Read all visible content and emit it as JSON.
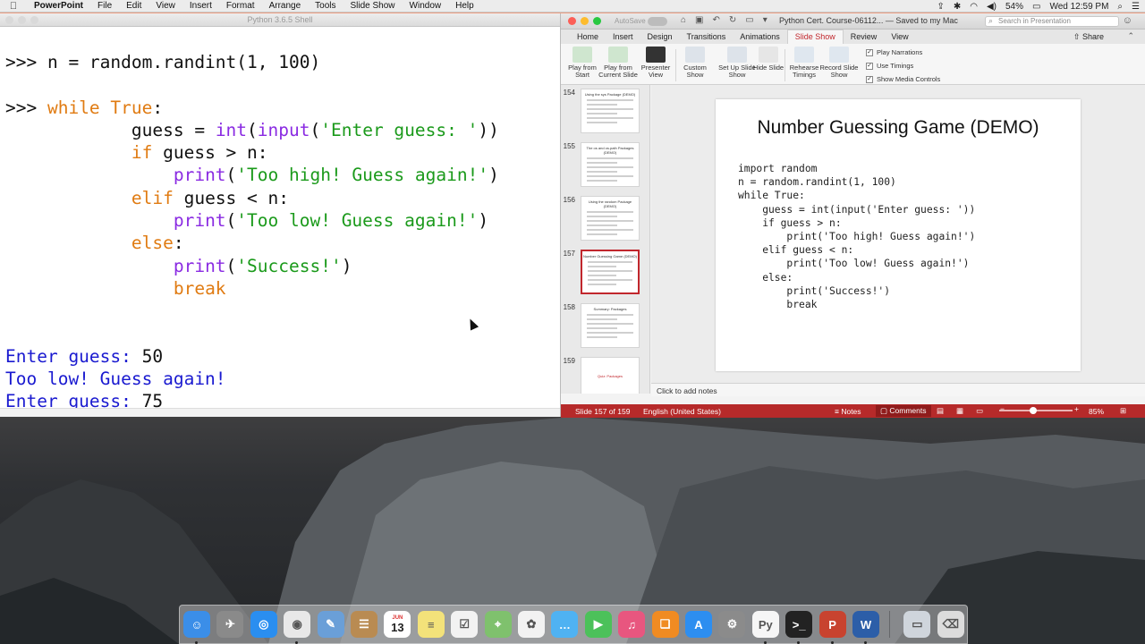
{
  "menubar": {
    "app": "PowerPoint",
    "items": [
      "File",
      "Edit",
      "View",
      "Insert",
      "Format",
      "Arrange",
      "Tools",
      "Slide Show",
      "Window",
      "Help"
    ],
    "battery": "54%",
    "clock": "Wed 12:59 PM"
  },
  "shell": {
    "title": "Python 3.6.5 Shell",
    "lines": [
      [
        {
          "t": ">>> n = random.randint(1, 100)",
          "c": ""
        }
      ],
      [
        {
          "t": "",
          "c": ""
        }
      ],
      [
        {
          "t": ">>> ",
          "c": ""
        },
        {
          "t": "while",
          "c": "kw"
        },
        {
          "t": " ",
          "c": ""
        },
        {
          "t": "True",
          "c": "kw"
        },
        {
          "t": ":",
          "c": ""
        }
      ],
      [
        {
          "t": "            guess = ",
          "c": ""
        },
        {
          "t": "int",
          "c": "bi"
        },
        {
          "t": "(",
          "c": ""
        },
        {
          "t": "input",
          "c": "bi"
        },
        {
          "t": "(",
          "c": ""
        },
        {
          "t": "'Enter guess: '",
          "c": "st"
        },
        {
          "t": "))",
          "c": ""
        }
      ],
      [
        {
          "t": "            ",
          "c": ""
        },
        {
          "t": "if",
          "c": "kw"
        },
        {
          "t": " guess > n:",
          "c": ""
        }
      ],
      [
        {
          "t": "                ",
          "c": ""
        },
        {
          "t": "print",
          "c": "bi"
        },
        {
          "t": "(",
          "c": ""
        },
        {
          "t": "'Too high! Guess again!'",
          "c": "st"
        },
        {
          "t": ")",
          "c": ""
        }
      ],
      [
        {
          "t": "            ",
          "c": ""
        },
        {
          "t": "elif",
          "c": "kw"
        },
        {
          "t": " guess < n:",
          "c": ""
        }
      ],
      [
        {
          "t": "                ",
          "c": ""
        },
        {
          "t": "print",
          "c": "bi"
        },
        {
          "t": "(",
          "c": ""
        },
        {
          "t": "'Too low! Guess again!'",
          "c": "st"
        },
        {
          "t": ")",
          "c": ""
        }
      ],
      [
        {
          "t": "            ",
          "c": ""
        },
        {
          "t": "else",
          "c": "kw"
        },
        {
          "t": ":",
          "c": ""
        }
      ],
      [
        {
          "t": "                ",
          "c": ""
        },
        {
          "t": "print",
          "c": "bi"
        },
        {
          "t": "(",
          "c": ""
        },
        {
          "t": "'Success!'",
          "c": "st"
        },
        {
          "t": ")",
          "c": ""
        }
      ],
      [
        {
          "t": "                ",
          "c": ""
        },
        {
          "t": "break",
          "c": "kw"
        }
      ],
      [
        {
          "t": "",
          "c": ""
        }
      ],
      [
        {
          "t": "",
          "c": ""
        }
      ],
      [
        {
          "t": "Enter guess: ",
          "c": "out"
        },
        {
          "t": "50",
          "c": ""
        }
      ],
      [
        {
          "t": "Too low! Guess again!",
          "c": "out"
        }
      ],
      [
        {
          "t": "Enter guess: ",
          "c": "out"
        },
        {
          "t": "75",
          "c": ""
        }
      ]
    ]
  },
  "ppt": {
    "autosave": "AutoSave",
    "title": "Python Cert. Course-06112...  — Saved to my Mac",
    "search_placeholder": "Search in Presentation",
    "tabs": [
      "Home",
      "Insert",
      "Design",
      "Transitions",
      "Animations",
      "Slide Show",
      "Review",
      "View"
    ],
    "active_tab": "Slide Show",
    "share": "Share",
    "ribbon": {
      "play_from_start": "Play from Start",
      "play_from_current": "Play from Current Slide",
      "presenter_view": "Presenter View",
      "custom_show": "Custom Show",
      "set_up": "Set Up Slide Show",
      "hide_slide": "Hide Slide",
      "rehearse": "Rehearse Timings",
      "record": "Record Slide Show",
      "play_narrations": "Play Narrations",
      "use_timings": "Use Timings",
      "show_media_controls": "Show Media Controls"
    },
    "thumbnails": [
      {
        "num": "154",
        "title": "Using the sys Package (DEMO)"
      },
      {
        "num": "155",
        "title": "The os and os.path Packages (DEMO)"
      },
      {
        "num": "156",
        "title": "Using the random Package (DEMO)"
      },
      {
        "num": "157",
        "title": "Number Guessing Game (DEMO)"
      },
      {
        "num": "158",
        "title": "Summary: Packages"
      },
      {
        "num": "159",
        "title": "Quiz: Packages"
      }
    ],
    "slide": {
      "title": "Number Guessing Game (DEMO)",
      "code": [
        "import random",
        "n = random.randint(1, 100)",
        "while True:",
        "    guess = int(input('Enter guess: '))",
        "    if guess > n:",
        "        print('Too high! Guess again!')",
        "    elif guess < n:",
        "        print('Too low! Guess again!')",
        "    else:",
        "        print('Success!')",
        "        break"
      ]
    },
    "notes_placeholder": "Click to add notes",
    "status": {
      "slide_pos": "Slide 157 of 159",
      "language": "English (United States)",
      "notes": "Notes",
      "comments": "Comments",
      "zoom": "85%",
      "zoom_level": 0.46
    }
  },
  "dock": {
    "calendar_month": "JUN",
    "calendar_day": "13",
    "icons": [
      {
        "name": "finder-icon",
        "color": "#3b8ee8"
      },
      {
        "name": "launchpad-icon",
        "color": "#8a8a8a"
      },
      {
        "name": "safari-icon",
        "color": "#2a8ef0"
      },
      {
        "name": "chrome-icon",
        "color": "#e8e8e8"
      },
      {
        "name": "preview-icon",
        "color": "#6a9fd8"
      },
      {
        "name": "contacts-icon",
        "color": "#b98b52"
      },
      {
        "name": "calendar-icon",
        "color": "#ffffff"
      },
      {
        "name": "notes-icon",
        "color": "#f3e27a"
      },
      {
        "name": "reminders-icon",
        "color": "#f2f2f2"
      },
      {
        "name": "maps-icon",
        "color": "#7fc16d"
      },
      {
        "name": "photos-icon",
        "color": "#f2f2f2"
      },
      {
        "name": "messages-icon",
        "color": "#4fb2f2"
      },
      {
        "name": "facetime-icon",
        "color": "#4cc15a"
      },
      {
        "name": "itunes-icon",
        "color": "#e8567f"
      },
      {
        "name": "ibooks-icon",
        "color": "#f08b22"
      },
      {
        "name": "app-store-icon",
        "color": "#2d8ef0"
      },
      {
        "name": "system-preferences-icon",
        "color": "#8b8b8b"
      },
      {
        "name": "python-icon",
        "color": "#f6f6f6"
      },
      {
        "name": "terminal-icon",
        "color": "#222222"
      },
      {
        "name": "powerpoint-icon",
        "color": "#c8432f"
      },
      {
        "name": "word-icon",
        "color": "#2c5ea8"
      },
      {
        "name": "documents-folder-icon",
        "color": "#cfd5dc"
      },
      {
        "name": "trash-icon",
        "color": "#dcdcdc"
      }
    ]
  }
}
